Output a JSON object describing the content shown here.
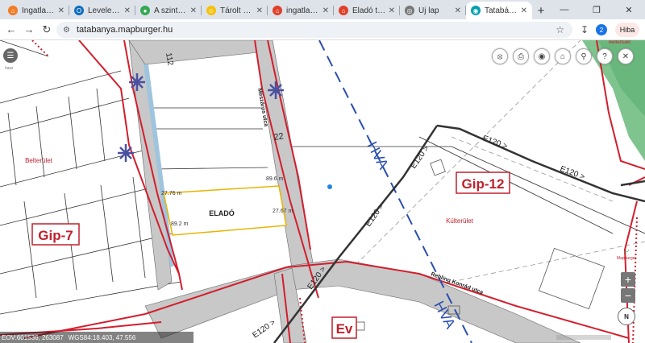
{
  "browser": {
    "tabs": [
      {
        "label": "Ingatlan szer",
        "icon_color": "#f07c24",
        "icon": "home-icon"
      },
      {
        "label": "Levelezés - I",
        "icon_color": "#0f6cbd",
        "icon": "outlook-icon"
      },
      {
        "label": "A szintterület",
        "icon_color": "#34a853",
        "icon": "maps-pin-icon"
      },
      {
        "label": "Tárolt cégkin",
        "icon_color": "#f4c20d",
        "icon": "smiley-icon"
      },
      {
        "label": "ingatlan.com",
        "icon_color": "#e0402a",
        "icon": "house-icon"
      },
      {
        "label": "Eladó tatabá",
        "icon_color": "#e0402a",
        "icon": "house-icon"
      },
      {
        "label": "Új lap",
        "icon_color": "#777777",
        "icon": "chrome-icon"
      },
      {
        "label": "Tatabánya té",
        "icon_color": "#00a0b0",
        "icon": "globe-icon"
      }
    ],
    "active_tab": 7,
    "url": "tatabanya.mapburger.hu",
    "profile_badge": "2",
    "error_label": "Hiba"
  },
  "map": {
    "labels": {
      "street_meszaros": "Mészáros utca",
      "street_rehling": "Rehling Konrád utca",
      "parcel_number_top": "112",
      "parcel_number_mid": "22",
      "beltertulet": "Belterület",
      "kulterulet": "Külterület",
      "zone_gip7": "Gip-7",
      "zone_gip12": "Gip-12",
      "zone_ev": "Ev",
      "hva_upper": "HVA",
      "hva_lower": "HVA",
      "e120_1": "E120 >",
      "e120_2": "E120 >",
      "e120_3": "E120 >",
      "e120_4": "E120 >",
      "e120_5": "E120 >",
      "e120_6": "E120 >",
      "elado": "ELADÓ",
      "dim_top": "89.6 m",
      "dim_left": "27.76 m",
      "dim_bottom": "89.2 m",
      "dim_right": "27.67 m",
      "menu_small": "hasz",
      "top_right_label": "Beltertulet"
    },
    "toolbar_icons": [
      "clear-icon",
      "print-icon",
      "eye-icon",
      "home-icon",
      "search-icon",
      "help-icon",
      "close-icon"
    ],
    "zoom_in": "+",
    "zoom_out": "−",
    "logo_label": "Mapburger",
    "compass_label": "N",
    "status": {
      "eov": "EOV:601536, 263087",
      "wgs": "WGS84:18.403, 47.556"
    },
    "colors": {
      "road": "#c8c8c8",
      "boundary": "#d21e2d",
      "hva_line": "#2a4fb0",
      "parcel_highlight": "#e8b400",
      "green_area": "#7fc48f",
      "zone_text": "#c0202c"
    }
  }
}
